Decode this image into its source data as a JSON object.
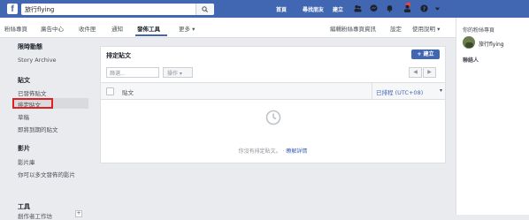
{
  "colors": {
    "brand": "#4267b2",
    "highlight": "#e02020"
  },
  "topbar": {
    "logo": "f",
    "search_value": "旅行flying",
    "nav": [
      "首頁",
      "尋找朋友",
      "建立"
    ],
    "icons": [
      "friends-icon",
      "messenger-icon",
      "notifications-icon",
      "help-icon",
      "account-menu-icon"
    ]
  },
  "pagebar": {
    "tabs": [
      "粉絲專頁",
      "廣告中心",
      "收件匣",
      "通知",
      "發佈工具",
      "更多 ▾"
    ],
    "active_tab": "發佈工具",
    "right_links": [
      "編輯粉絲專頁資訊",
      "設定",
      "使用說明 ▾"
    ]
  },
  "leftnav": {
    "stories_header": "限時動態",
    "story_archive": "Story Archive",
    "posts_header": "貼文",
    "posts_items": [
      "已發佈貼文",
      "排定貼文",
      "草稿",
      "即將到期的貼文"
    ],
    "video_header": "影片",
    "video_items": [
      "影片庫",
      "你可以多文發佈的影片"
    ],
    "tools_header": "工具",
    "tools_item": "創作者工作坊"
  },
  "panel": {
    "title": "排定貼文",
    "new_button": "+ 建立",
    "filter_placeholder": "篩選...",
    "action_label": "操作 ▾",
    "pager_prev": "◀",
    "pager_next": "▶",
    "col_post": "貼文",
    "col_time": "已排程 (UTC+08)",
    "empty_text": "你沒有排定貼文。",
    "empty_link": "瞭解詳情"
  },
  "rightcol": {
    "header": "你的粉絲專頁",
    "page_name": "旅行flying",
    "contacts": "聯絡人"
  }
}
